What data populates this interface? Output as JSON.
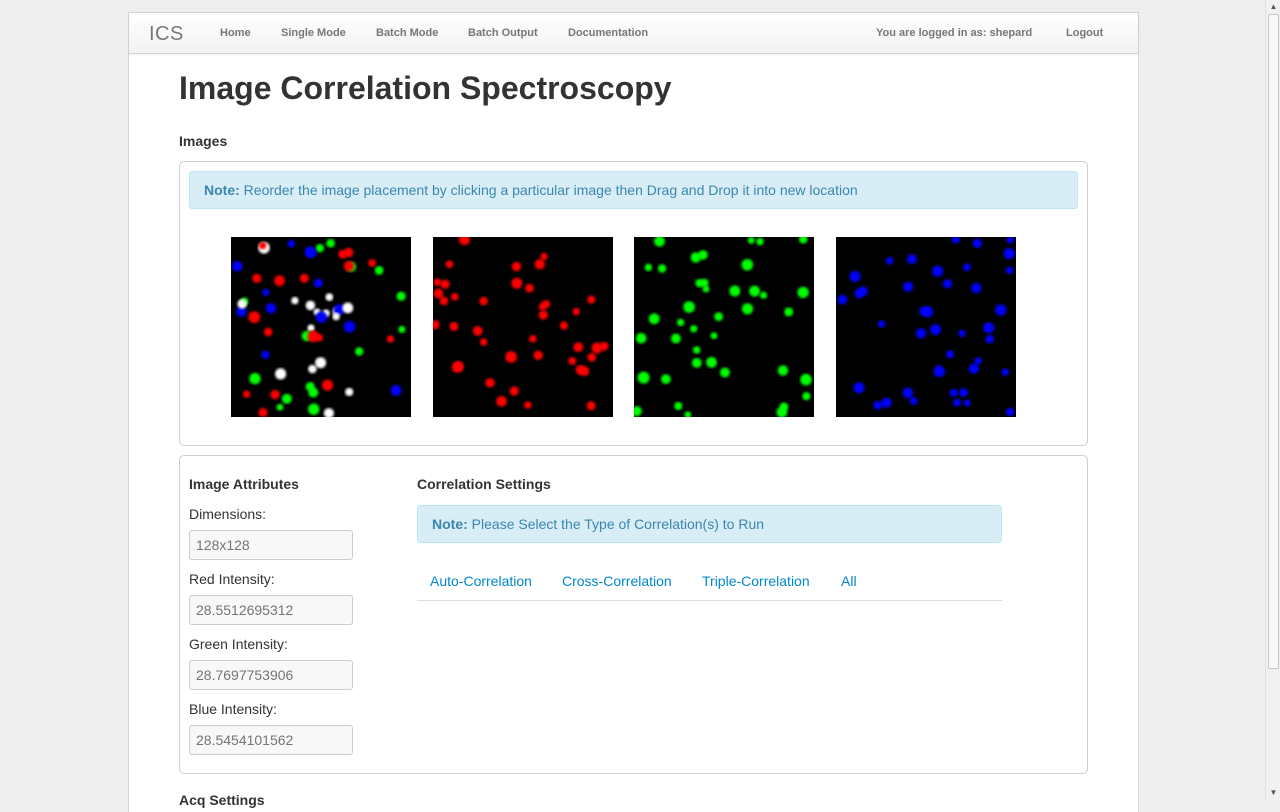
{
  "navbar": {
    "brand": "ICS",
    "items": [
      "Home",
      "Single Mode",
      "Batch Mode",
      "Batch Output",
      "Documentation"
    ],
    "logged_in": "You are logged in as: shepard",
    "logout": "Logout"
  },
  "page": {
    "title": "Image Correlation Spectroscopy",
    "images_label": "Images",
    "images_note_bold": "Note:",
    "images_note_text": "Reorder the image placement by clicking a particular image then Drag and Drop it into new location"
  },
  "attributes": {
    "heading": "Image Attributes",
    "dimensions_label": "Dimensions:",
    "dimensions_value": "128x128",
    "red_label": "Red Intensity:",
    "red_value": "28.5512695312",
    "green_label": "Green Intensity:",
    "green_value": "28.7697753906",
    "blue_label": "Blue Intensity:",
    "blue_value": "28.5454101562"
  },
  "correlation": {
    "heading": "Correlation Settings",
    "note_bold": "Note:",
    "note_text": "Please Select the Type of Correlation(s) to Run",
    "tabs": [
      "Auto-Correlation",
      "Cross-Correlation",
      "Triple-Correlation",
      "All"
    ]
  },
  "next_section_label": "Acq Settings",
  "images": [
    {
      "name": "composite",
      "colors": [
        "#ff0000",
        "#00ff00",
        "#0000ff",
        "#ffffff"
      ]
    },
    {
      "name": "red-channel",
      "colors": [
        "#ff0000"
      ]
    },
    {
      "name": "green-channel",
      "colors": [
        "#00ff00"
      ]
    },
    {
      "name": "blue-channel",
      "colors": [
        "#0000ff"
      ]
    }
  ]
}
